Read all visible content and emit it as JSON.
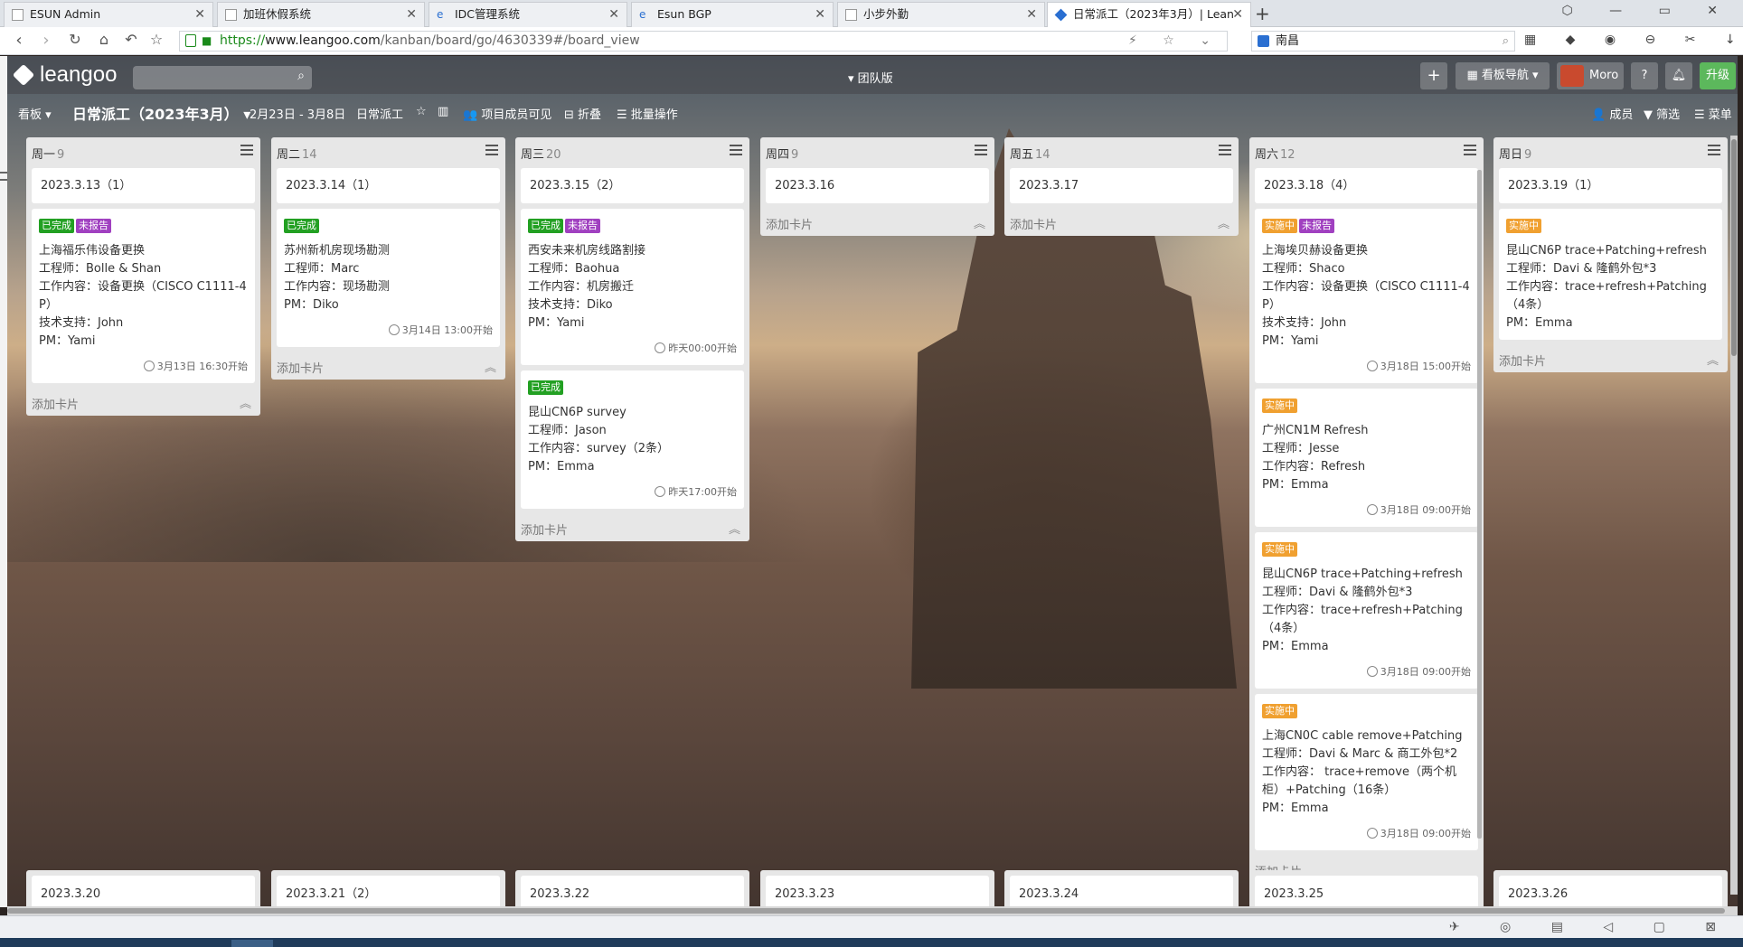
{
  "browser": {
    "tabs": [
      {
        "title": "ESUN Admin",
        "icon": "page-icon"
      },
      {
        "title": "加班休假系统",
        "icon": "page-icon"
      },
      {
        "title": "IDC管理系统",
        "icon": "ie-icon"
      },
      {
        "title": "Esun BGP",
        "icon": "ie-icon"
      },
      {
        "title": "小步外勤",
        "icon": "page-icon"
      },
      {
        "title": "日常派工（2023年3月）| Lean",
        "icon": "leangoo-icon",
        "active": true
      }
    ],
    "url": {
      "scheme": "https://",
      "host": "www.leangoo.com",
      "path": "/kanban/board/go/4630339#/board_view"
    },
    "search_value": "南昌"
  },
  "app": {
    "logo_text": "leangoo",
    "team_label": "▾ 团队版",
    "board_nav_label": "看板导航 ▾",
    "user_name": "Moro",
    "help_label": "?",
    "upgrade_label": "升级",
    "plus_label": "+"
  },
  "toolbar": {
    "view_label": "看板 ▾",
    "board_name": "日常派工（2023年3月） ▾",
    "date_range": "2月23日 - 3月8日",
    "tag": "日常派工",
    "star": "☆",
    "chart": "▥",
    "visibility": "👥 项目成员可见",
    "fold": "⊟ 折叠",
    "batch": "☰ 批量操作",
    "members": "👤 成员",
    "filter": "▼ 筛选",
    "menu": "☰ 菜单"
  },
  "lists": [
    {
      "name": "周一",
      "count": "9",
      "title_card": "2023.3.13（1）",
      "cards": [
        {
          "badges": [
            {
              "text": "已完成",
              "type": "done"
            },
            {
              "text": "未报告",
              "type": "unrep"
            }
          ],
          "lines": [
            "上海福乐伟设备更换",
            "工程师：Bolle & Shan",
            "工作内容：设备更换（CISCO C1111-4P）",
            "技术支持：John",
            "PM：Yami"
          ],
          "time": "3月13日 16:30开始"
        }
      ],
      "add_label": "添加卡片"
    },
    {
      "name": "周二",
      "count": "14",
      "title_card": "2023.3.14（1）",
      "cards": [
        {
          "badges": [
            {
              "text": "已完成",
              "type": "done"
            }
          ],
          "lines": [
            "苏州新机房现场勘测",
            "工程师：Marc",
            "工作内容：现场勘测",
            "PM：Diko"
          ],
          "time": "3月14日 13:00开始"
        }
      ],
      "add_label": "添加卡片"
    },
    {
      "name": "周三",
      "count": "20",
      "title_card": "2023.3.15（2）",
      "cards": [
        {
          "badges": [
            {
              "text": "已完成",
              "type": "done"
            },
            {
              "text": "未报告",
              "type": "unrep"
            }
          ],
          "lines": [
            "西安未来机房线路割接",
            "工程师：Baohua",
            "工作内容：机房搬迁",
            "技术支持：Diko",
            "PM：Yami"
          ],
          "time": "昨天00:00开始"
        },
        {
          "badges": [
            {
              "text": "已完成",
              "type": "done"
            }
          ],
          "lines": [
            "昆山CN6P survey",
            "工程师：Jason",
            "工作内容：survey（2条）",
            "PM：Emma"
          ],
          "time": "昨天17:00开始"
        }
      ],
      "add_label": "添加卡片"
    },
    {
      "name": "周四",
      "count": "9",
      "title_card": "2023.3.16",
      "cards": [],
      "add_label": "添加卡片"
    },
    {
      "name": "周五",
      "count": "14",
      "title_card": "2023.3.17",
      "cards": [],
      "add_label": "添加卡片"
    },
    {
      "name": "周六",
      "count": "12",
      "title_card": "2023.3.18（4）",
      "cards": [
        {
          "badges": [
            {
              "text": "实施中",
              "type": "doing"
            },
            {
              "text": "未报告",
              "type": "unrep"
            }
          ],
          "lines": [
            "上海埃贝赫设备更换",
            "工程师：Shaco",
            "工作内容：设备更换（CISCO C1111-4P）",
            "技术支持：John",
            "PM：Yami"
          ],
          "time": "3月18日 15:00开始"
        },
        {
          "badges": [
            {
              "text": "实施中",
              "type": "doing"
            }
          ],
          "lines": [
            "广州CN1M Refresh",
            "工程师：Jesse",
            "工作内容：Refresh",
            "PM：Emma"
          ],
          "time": "3月18日 09:00开始"
        },
        {
          "badges": [
            {
              "text": "实施中",
              "type": "doing"
            }
          ],
          "lines": [
            "昆山CN6P trace+Patching+refresh",
            "工程师：Davi & 隆鹤外包*3",
            "工作内容：trace+refresh+Patching（4条）",
            "PM：Emma"
          ],
          "time": "3月18日 09:00开始"
        },
        {
          "badges": [
            {
              "text": "实施中",
              "type": "doing"
            }
          ],
          "lines": [
            "上海CN0C cable remove+Patching",
            "工程师：Davi & Marc & 商工外包*2",
            "工作内容： trace+remove（两个机柜）+Patching（16条）",
            "PM：Emma"
          ],
          "time": "3月18日 09:00开始"
        }
      ],
      "add_label": "添加卡片"
    },
    {
      "name": "周日",
      "count": "9",
      "title_card": "2023.3.19（1）",
      "cards": [
        {
          "badges": [
            {
              "text": "实施中",
              "type": "doing"
            }
          ],
          "lines": [
            "昆山CN6P trace+Patching+refresh",
            "工程师：Davi & 隆鹤外包*3",
            "工作内容：trace+refresh+Patching（4条）",
            "PM：Emma"
          ],
          "time": ""
        }
      ],
      "add_label": "添加卡片"
    }
  ],
  "row2_titles": [
    "2023.3.20",
    "2023.3.21（2）",
    "2023.3.22",
    "2023.3.23",
    "2023.3.24",
    "2023.3.25",
    "2023.3.26"
  ],
  "colors": {
    "done": "#22a022",
    "unreported": "#a040c0",
    "in_progress": "#f0a030",
    "upgrade": "#5cb85c"
  }
}
